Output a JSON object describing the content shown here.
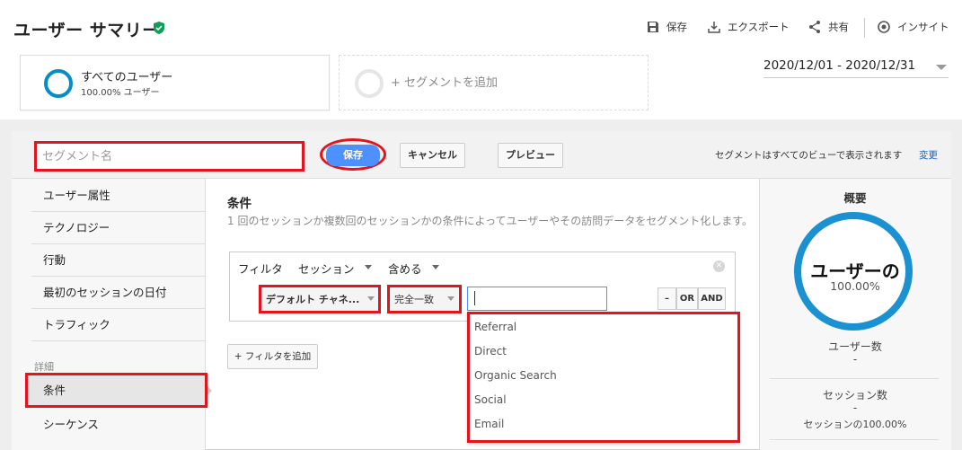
{
  "header": {
    "title": "ユーザー サマリー",
    "toolbar": [
      {
        "icon": "save-icon",
        "label": "保存"
      },
      {
        "icon": "export-icon",
        "label": "エクスポート"
      },
      {
        "icon": "share-icon",
        "label": "共有"
      },
      {
        "icon": "insight-icon",
        "label": "インサイト"
      }
    ]
  },
  "segments": {
    "all_users": {
      "name": "すべてのユーザー",
      "percent": "100.00% ユーザー"
    },
    "add_label": "+ セグメントを追加"
  },
  "date_range": "2020/12/01 - 2020/12/31",
  "editor": {
    "name_placeholder": "セグメント名",
    "save_label": "保存",
    "cancel_label": "キャンセル",
    "preview_label": "プレビュー",
    "view_note": "セグメントはすべてのビューで表示されます",
    "change_label": "変更"
  },
  "nav": {
    "items": [
      "ユーザー属性",
      "テクノロジー",
      "行動",
      "最初のセッションの日付",
      "トラフィック"
    ],
    "section_label": "詳細",
    "conditions_label": "条件",
    "sequence_label": "シーケンス"
  },
  "conditions": {
    "title": "条件",
    "description": "1 回のセッションか複数回のセッションかの条件によってユーザーやその訪問データをセグメント化します。",
    "filter_label": "フィルタ",
    "scope_label": "セッション",
    "include_label": "含める",
    "dimension_label": "デフォルト チャネ...",
    "match_label": "完全一致",
    "value": "",
    "or_label": "OR",
    "and_label": "AND",
    "remove_label": "–",
    "add_filter_label": "+ フィルタを追加",
    "dropdown_options": [
      "Referral",
      "Direct",
      "Organic Search",
      "Social",
      "Email"
    ]
  },
  "summary": {
    "title": "概要",
    "ring_label": "ユーザーの",
    "ring_percent": "100.00%",
    "users_label": "ユーザー数",
    "users_value": "-",
    "sessions_label": "セッション数",
    "sessions_value": "-",
    "sessions_pct": "セッションの100.00%"
  },
  "colors": {
    "accent": "#4d90fe",
    "highlight": "#e3141c",
    "ring": "#1a91d1",
    "verified": "#0f9d58"
  }
}
